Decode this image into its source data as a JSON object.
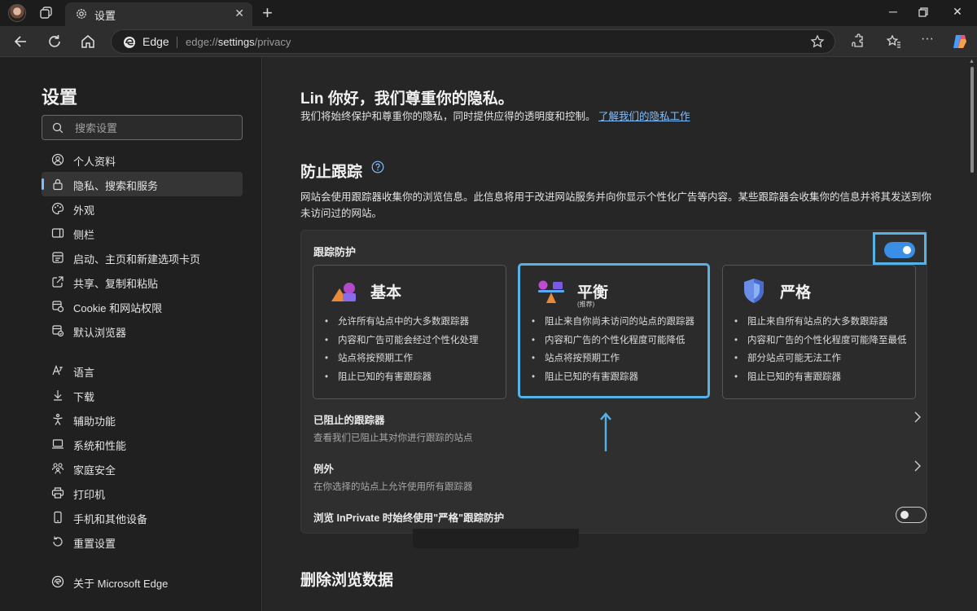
{
  "tab": {
    "title": "设置"
  },
  "address": {
    "edge_label": "Edge",
    "url_prefix": "edge://",
    "url_bold": "settings",
    "url_suffix": "/privacy"
  },
  "sidebar": {
    "title": "设置",
    "search_placeholder": "搜索设置",
    "items": [
      {
        "label": "个人资料",
        "icon": "profile-icon"
      },
      {
        "label": "隐私、搜索和服务",
        "icon": "lock-icon",
        "active": true
      },
      {
        "label": "外观",
        "icon": "appearance-icon"
      },
      {
        "label": "侧栏",
        "icon": "sidebar-icon"
      },
      {
        "label": "启动、主页和新建选项卡页",
        "icon": "startup-icon"
      },
      {
        "label": "共享、复制和粘贴",
        "icon": "share-icon"
      },
      {
        "label": "Cookie 和网站权限",
        "icon": "cookie-icon"
      },
      {
        "label": "默认浏览器",
        "icon": "browser-icon"
      },
      {
        "label": "语言",
        "icon": "language-icon"
      },
      {
        "label": "下载",
        "icon": "download-icon"
      },
      {
        "label": "辅助功能",
        "icon": "accessibility-icon"
      },
      {
        "label": "系统和性能",
        "icon": "system-icon"
      },
      {
        "label": "家庭安全",
        "icon": "family-icon"
      },
      {
        "label": "打印机",
        "icon": "printer-icon"
      },
      {
        "label": "手机和其他设备",
        "icon": "phone-icon"
      },
      {
        "label": "重置设置",
        "icon": "reset-icon"
      },
      {
        "label": "关于 Microsoft Edge",
        "icon": "edge-icon"
      }
    ]
  },
  "main": {
    "greeting": "Lin 你好，我们尊重你的隐私。",
    "greeting_desc": "我们将始终保护和尊重你的隐私，同时提供应得的透明度和控制。",
    "privacy_link": "了解我们的隐私工作",
    "tracking": {
      "title": "防止跟踪",
      "desc": "网站会使用跟踪器收集你的浏览信息。此信息将用于改进网站服务并向你显示个性化广告等内容。某些跟踪器会收集你的信息并将其发送到你未访问过的网站。",
      "label": "跟踪防护",
      "enabled": true,
      "options": [
        {
          "name": "基本",
          "sub": "",
          "selected": false,
          "bullets": [
            "允许所有站点中的大多数跟踪器",
            "内容和广告可能会经过个性化处理",
            "站点将按预期工作",
            "阻止已知的有害跟踪器"
          ]
        },
        {
          "name": "平衡",
          "sub": "(推荐)",
          "selected": true,
          "bullets": [
            "阻止来自你尚未访问的站点的跟踪器",
            "内容和广告的个性化程度可能降低",
            "站点将按预期工作",
            "阻止已知的有害跟踪器"
          ]
        },
        {
          "name": "严格",
          "sub": "",
          "selected": false,
          "bullets": [
            "阻止来自所有站点的大多数跟踪器",
            "内容和广告的个性化程度可能降至最低",
            "部分站点可能无法工作",
            "阻止已知的有害跟踪器"
          ]
        }
      ],
      "blocked": {
        "title": "已阻止的跟踪器",
        "sub": "查看我们已阻止其对你进行跟踪的站点"
      },
      "exceptions": {
        "title": "例外",
        "sub": "在你选择的站点上允许使用所有跟踪器"
      },
      "inprivate": {
        "title": "浏览 InPrivate 时始终使用\"严格\"跟踪防护",
        "enabled": false
      }
    },
    "clear_data": {
      "title": "删除浏览数据"
    }
  },
  "colors": {
    "accent": "#54b2e6",
    "toggle_on": "#3a8ee6",
    "link": "#7fbfff"
  }
}
